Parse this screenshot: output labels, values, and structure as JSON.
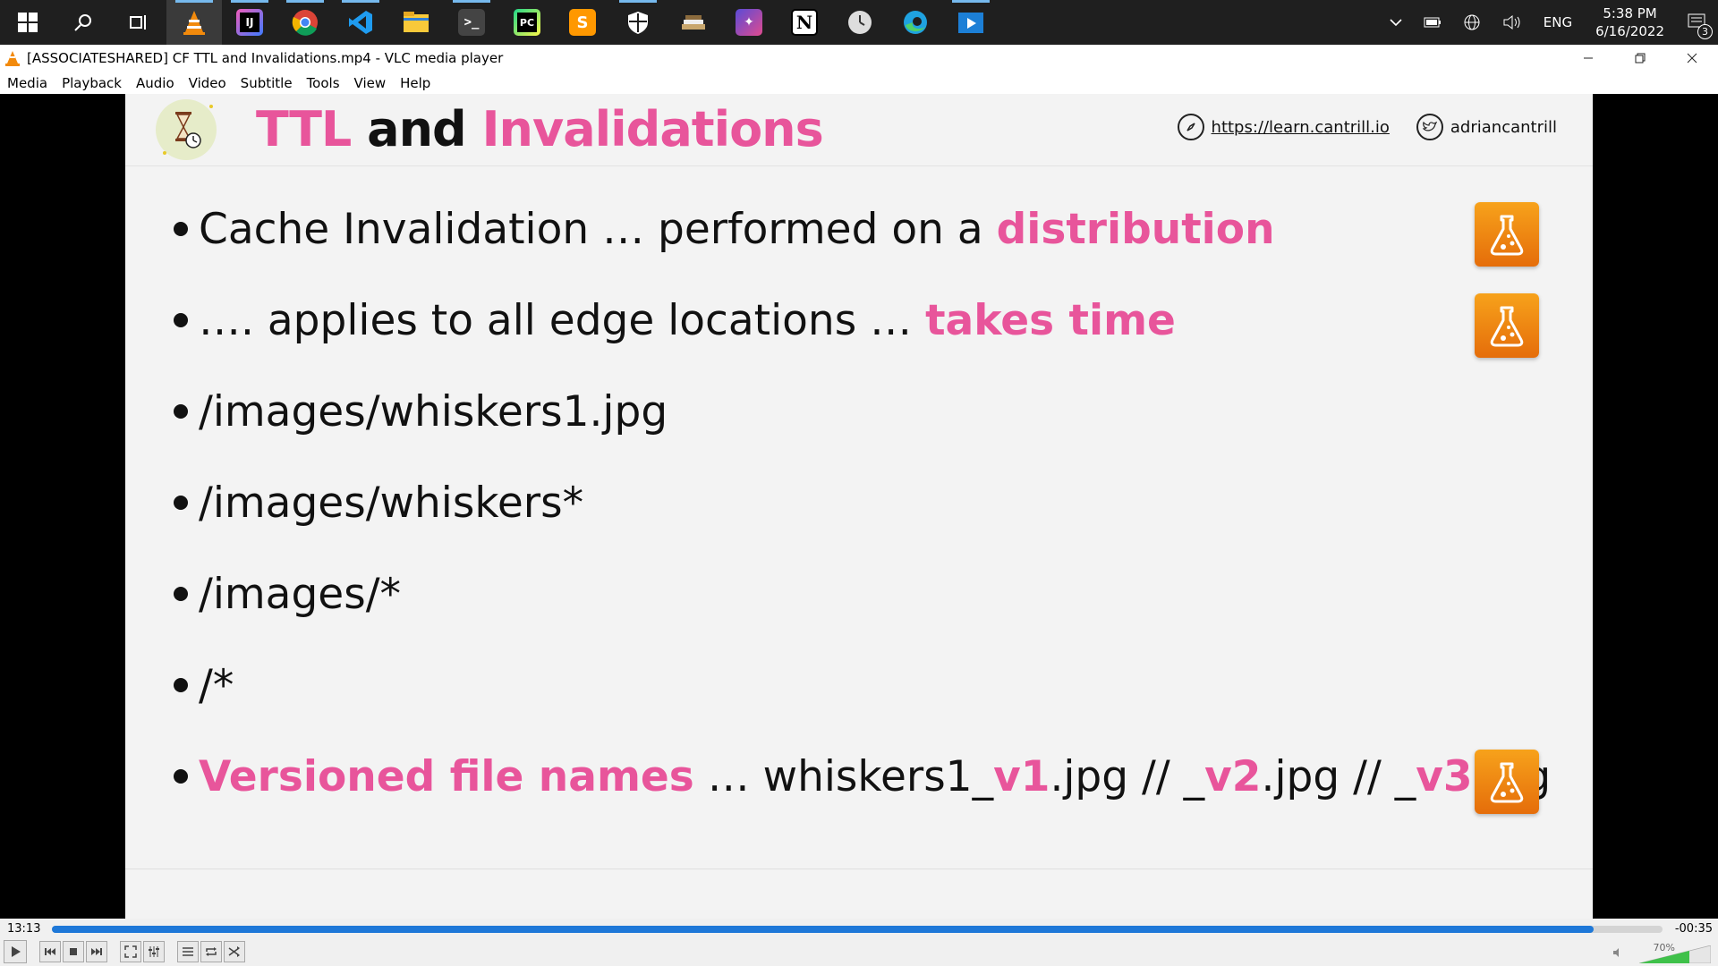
{
  "taskbar": {
    "apps": [
      {
        "name": "start-icon"
      },
      {
        "name": "search-icon"
      },
      {
        "name": "task-view-icon"
      },
      {
        "name": "vlc-icon"
      },
      {
        "name": "intellij-icon"
      },
      {
        "name": "chrome-icon"
      },
      {
        "name": "vscode-icon"
      },
      {
        "name": "file-explorer-icon"
      },
      {
        "name": "terminal-icon"
      },
      {
        "name": "pycharm-icon"
      },
      {
        "name": "sublime-icon"
      },
      {
        "name": "security-icon"
      },
      {
        "name": "books-icon"
      },
      {
        "name": "photos-icon"
      },
      {
        "name": "notion-icon"
      },
      {
        "name": "clock-app-icon"
      },
      {
        "name": "edge-icon"
      },
      {
        "name": "media-player-icon"
      }
    ],
    "tray": {
      "language": "ENG",
      "time": "5:38 PM",
      "date": "6/16/2022",
      "notification_count": "3"
    }
  },
  "window": {
    "title": "[ASSOCIATESHARED] CF TTL and Invalidations.mp4 - VLC media player",
    "menu": [
      "Media",
      "Playback",
      "Audio",
      "Video",
      "Subtitle",
      "Tools",
      "View",
      "Help"
    ]
  },
  "slide": {
    "title_part1": "TTL",
    "title_part2": " and ",
    "title_part3": "Invalidations",
    "site_link": "https://learn.cantrill.io",
    "twitter_handle": "adriancantrill",
    "bullets": [
      {
        "pre": "Cache Invalidation … performed on a ",
        "strong": "distribution",
        "post": "",
        "lab": true
      },
      {
        "pre": "…. applies to all edge locations … ",
        "strong": "takes time",
        "post": "",
        "lab": true
      },
      {
        "pre": "/images/whiskers1.jpg",
        "strong": "",
        "post": "",
        "lab": false
      },
      {
        "pre": "/images/whiskers*",
        "strong": "",
        "post": "",
        "lab": false
      },
      {
        "pre": "/images/*",
        "strong": "",
        "post": "",
        "lab": false
      },
      {
        "pre": "/*",
        "strong": "",
        "post": "",
        "lab": false
      }
    ],
    "versioned": {
      "label": "Versioned file names",
      "t1": " … whiskers1_",
      "v1": "v1",
      "t2": ".jpg // _",
      "v2": "v2",
      "t3": ".jpg // _",
      "v3": "v3",
      "t4": ".jpg"
    }
  },
  "player": {
    "current_time": "13:13",
    "remaining_time": "-00:35",
    "progress": 0.957,
    "volume_label": "70%",
    "volume": 0.7
  },
  "colors": {
    "accent_pink": "#e8559b",
    "seek_blue": "#1e78d8",
    "lab_orange": "#f08a12"
  }
}
